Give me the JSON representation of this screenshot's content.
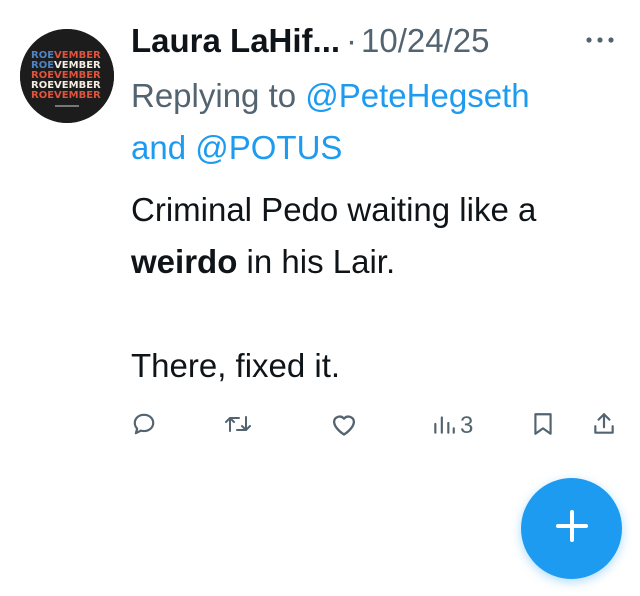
{
  "tweet": {
    "author_name": "Laura LaHif...",
    "separator": "·",
    "date": "10/24/25",
    "reply_prefix": "Replying to ",
    "reply_mention_1": "@PeteHegseth",
    "reply_and": " and ",
    "reply_mention_2": "@POTUS",
    "body_line1": "Criminal Pedo waiting like a",
    "body_bold": "weirdo",
    "body_line2_rest": " in his Lair.",
    "body_line3": "There, fixed it.",
    "views_count": "3"
  },
  "avatar": {
    "text_lines": [
      "ROEVEMBER",
      "ROEVEMBER",
      "ROEVEMBER",
      "ROEVEMBER",
      "ROEVEMBER"
    ],
    "colors": [
      "#e0533c",
      "#f4efe4",
      "#4e84c4"
    ]
  },
  "icons": {
    "more": "more-horizontal-icon",
    "reply": "reply-icon",
    "retweet": "retweet-icon",
    "like": "heart-icon",
    "views": "views-icon",
    "bookmark": "bookmark-icon",
    "share": "share-icon",
    "compose": "plus-icon"
  },
  "colors": {
    "accent": "#1d9bf0",
    "text": "#0f1419",
    "secondary": "#536471"
  }
}
